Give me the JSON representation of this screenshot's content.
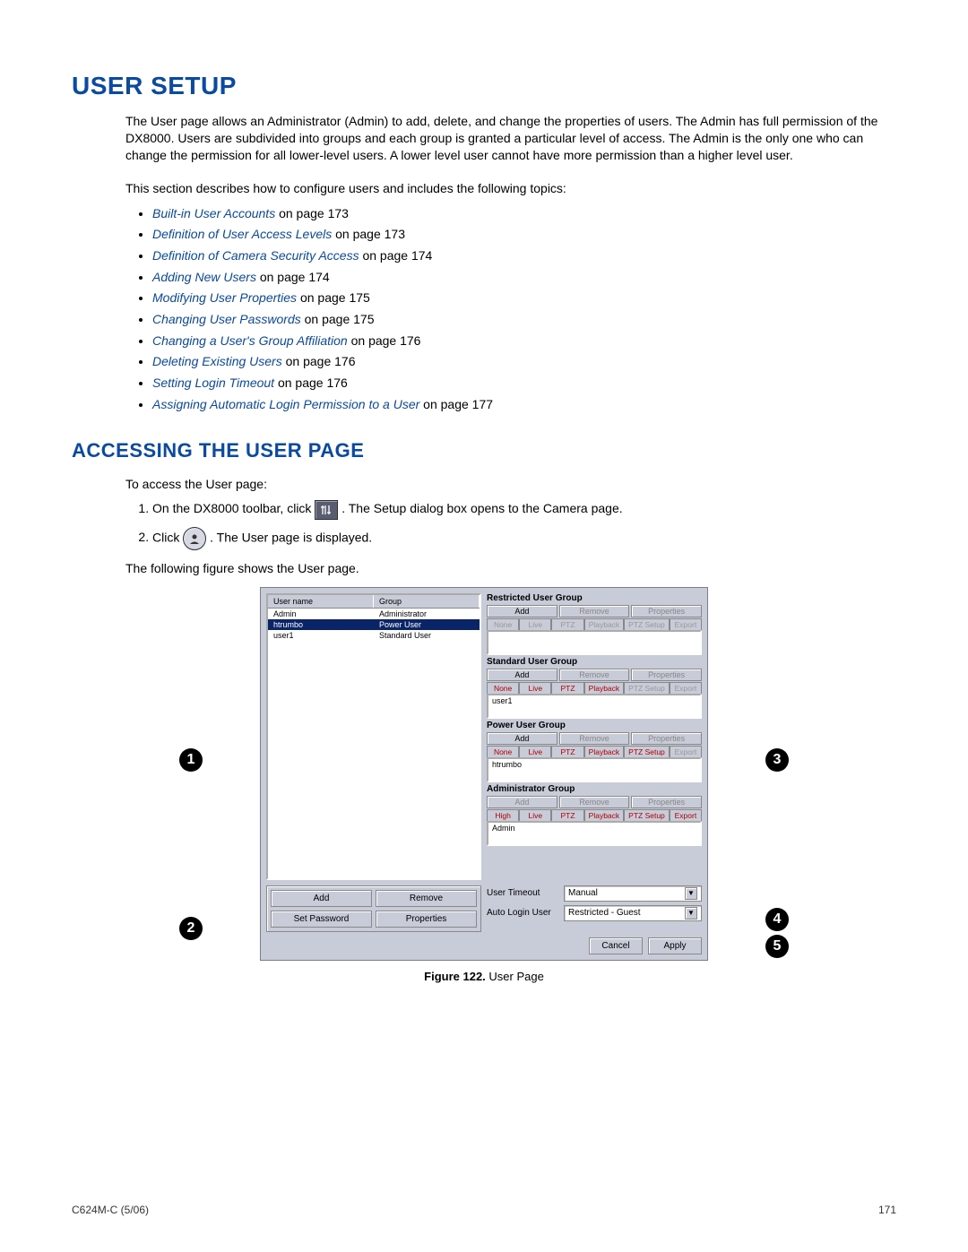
{
  "heading1": "USER SETUP",
  "intro": "The User page allows an Administrator (Admin) to add, delete, and change the properties of users. The Admin has full permission of the DX8000. Users are subdivided into groups and each group is granted a particular level of access. The Admin is the only one who can change the permission for all lower-level users. A lower level user cannot have more permission than a higher level user.",
  "intro2": "This section describes how to configure users and includes the following topics:",
  "toc": [
    {
      "label": "Built-in User Accounts",
      "page": " on page 173"
    },
    {
      "label": "Definition of User Access Levels",
      "page": " on page 173"
    },
    {
      "label": "Definition of Camera Security Access",
      "page": " on page 174"
    },
    {
      "label": "Adding New Users",
      "page": " on page 174"
    },
    {
      "label": "Modifying User Properties",
      "page": " on page 175"
    },
    {
      "label": "Changing User Passwords",
      "page": " on page 175"
    },
    {
      "label": "Changing a User's Group Affiliation",
      "page": " on page 176"
    },
    {
      "label": "Deleting Existing Users",
      "page": " on page 176"
    },
    {
      "label": "Setting Login Timeout",
      "page": " on page 176"
    },
    {
      "label": "Assigning Automatic Login Permission to a User",
      "page": " on page 177"
    }
  ],
  "heading2": "ACCESSING THE USER PAGE",
  "access_intro": "To access the User page:",
  "steps": {
    "s1a": "On the DX8000 toolbar, click ",
    "s1b": ". The Setup dialog box opens to the Camera page.",
    "s2a": "Click ",
    "s2b": ". The User page is displayed."
  },
  "figure_intro": "The following figure shows the User page.",
  "figure_caption_bold": "Figure 122.",
  "figure_caption_rest": "  User Page",
  "dialog": {
    "cols": {
      "a": "User name",
      "b": "Group"
    },
    "rows": [
      {
        "name": "Admin",
        "group": "Administrator",
        "sel": false
      },
      {
        "name": "htrumbo",
        "group": "Power User",
        "sel": true
      },
      {
        "name": "user1",
        "group": "Standard User",
        "sel": false
      }
    ],
    "groups": [
      {
        "title": "Restricted User Group",
        "list": "",
        "tabs_enabled": false,
        "add": true,
        "remove": false,
        "props": false
      },
      {
        "title": "Standard User Group",
        "list": "user1",
        "tabs_enabled": true,
        "add": true,
        "remove": false,
        "props": false
      },
      {
        "title": "Power User Group",
        "list": "htrumbo",
        "tabs_enabled": true,
        "add": true,
        "remove": false,
        "props": false
      },
      {
        "title": "Administrator Group",
        "list": "Admin",
        "tabs_enabled": true,
        "add": false,
        "remove": false,
        "props": false,
        "high": true
      }
    ],
    "group_btn_labels": {
      "add": "Add",
      "remove": "Remove",
      "props": "Properties"
    },
    "tab_labels": [
      "None",
      "Live",
      "PTZ",
      "Playback",
      "PTZ Setup",
      "Export"
    ],
    "tab_high": "High",
    "left_btns": [
      "Add",
      "Remove",
      "Set Password",
      "Properties"
    ],
    "timeout": {
      "label": "User Timeout",
      "value": "Manual"
    },
    "autologin": {
      "label": "Auto Login User",
      "value": "Restricted - Guest"
    },
    "actions": {
      "cancel": "Cancel",
      "apply": "Apply"
    }
  },
  "callouts": [
    "1",
    "2",
    "3",
    "4",
    "5"
  ],
  "footer": {
    "left": "C624M-C (5/06)",
    "right": "171"
  }
}
